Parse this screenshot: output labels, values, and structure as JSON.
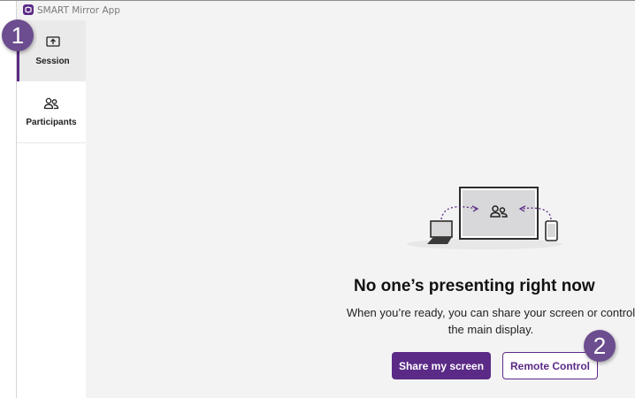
{
  "app": {
    "title": "SMART Mirror App",
    "icon": "app-logo-icon"
  },
  "sidebar": {
    "items": [
      {
        "label": "Session",
        "icon": "screen-share-icon",
        "active": true
      },
      {
        "label": "Participants",
        "icon": "people-icon",
        "active": false
      }
    ]
  },
  "main": {
    "illustration": {
      "icon": "people-icon"
    },
    "title": "No one’s presenting right now",
    "description": "When you’re ready, you can share your screen or control the main display.",
    "buttons": {
      "share_label": "Share my screen",
      "remote_label": "Remote Control"
    }
  },
  "callouts": [
    "1",
    "2"
  ],
  "colors": {
    "accent": "#5b2a86",
    "callout": "#6c4d8f",
    "background": "#f4f3f4"
  }
}
